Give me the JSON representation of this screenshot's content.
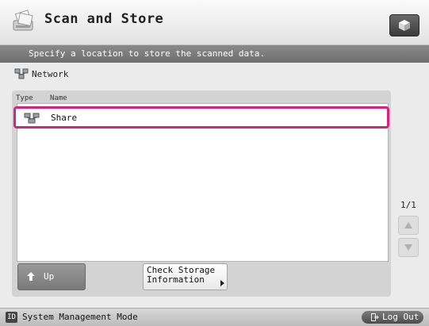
{
  "header": {
    "title": "Scan and Store"
  },
  "instruction": "Specify a location to store the scanned data.",
  "location": {
    "label": "Network",
    "icon": "network-icon"
  },
  "list": {
    "columns": [
      "Type",
      "Name"
    ],
    "items": [
      {
        "type_icon": "network-share-icon",
        "name": "Share",
        "selected": true
      }
    ]
  },
  "buttons": {
    "up": "Up",
    "check_storage": "Check Storage\nInformation"
  },
  "pager": {
    "page": "1/1"
  },
  "status": {
    "id_badge": "ID",
    "mode": "System Management Mode",
    "logout": "Log Out"
  },
  "colors": {
    "selection": "#d6247e",
    "instruction_bar": "#7a7a7a",
    "header": "#f2f2f2"
  }
}
